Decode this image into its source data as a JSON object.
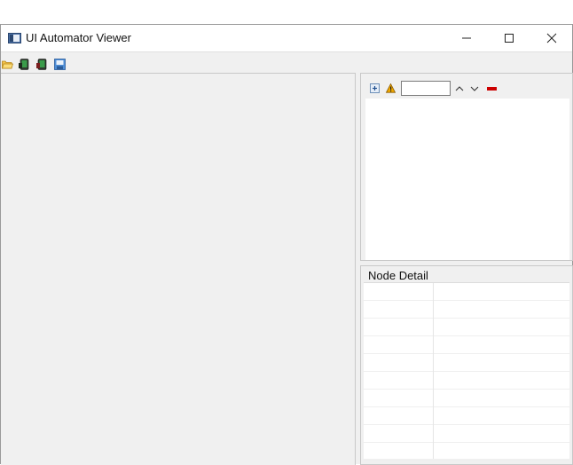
{
  "window": {
    "title": "UI Automator Viewer",
    "controls": {
      "minimize": "minimize",
      "maximize": "maximize",
      "close": "close"
    }
  },
  "toolbar": {
    "items": [
      {
        "name": "open-icon",
        "tooltip": ""
      },
      {
        "name": "device-screenshot-icon",
        "tooltip": ""
      },
      {
        "name": "device-screenshot-compressed-icon",
        "tooltip": ""
      },
      {
        "name": "save-icon",
        "tooltip": ""
      }
    ]
  },
  "hierarchy": {
    "expand_icon": "expand-all-icon",
    "warning_icon": "warning-icon",
    "search": {
      "value": "",
      "placeholder": ""
    },
    "prev_icon": "chevron-up-icon",
    "next_icon": "chevron-down-icon",
    "clear_icon": "clear-icon"
  },
  "node_detail": {
    "title": "Node Detail",
    "rows": [
      {
        "key": "",
        "value": ""
      },
      {
        "key": "",
        "value": ""
      },
      {
        "key": "",
        "value": ""
      },
      {
        "key": "",
        "value": ""
      },
      {
        "key": "",
        "value": ""
      },
      {
        "key": "",
        "value": ""
      },
      {
        "key": "",
        "value": ""
      },
      {
        "key": "",
        "value": ""
      },
      {
        "key": "",
        "value": ""
      },
      {
        "key": "",
        "value": ""
      }
    ]
  },
  "colors": {
    "background": "#f0f0f0",
    "panel_white": "#ffffff",
    "accent_red": "#cc0000",
    "warning": "#e8a000"
  }
}
